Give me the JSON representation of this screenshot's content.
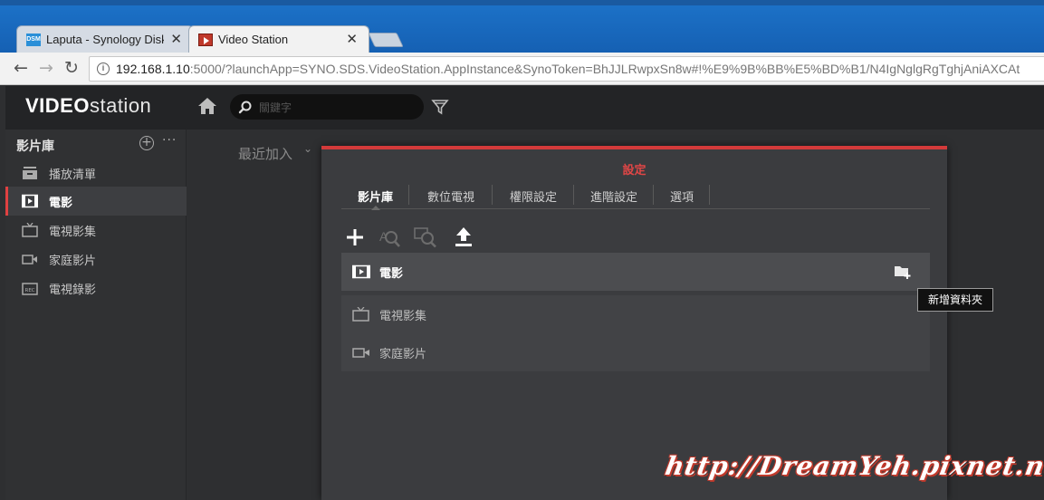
{
  "browser": {
    "tabs": [
      {
        "title": "Laputa - Synology DiskStation",
        "favicon": "dsm-icon",
        "favicon_text": "DSM",
        "active": false
      },
      {
        "title": "Video Station",
        "favicon": "video-station-icon",
        "active": true
      }
    ],
    "close_glyph": "✕",
    "url_host": "192.168.1.10",
    "url_rest": ":5000/?launchApp=SYNO.SDS.VideoStation.AppInstance&SynoToken=BhJJLRwpxSn8w#!%E9%9B%BB%E5%BD%B1/N4IgNglgRgTghjAniAXCAt",
    "back_glyph": "←",
    "forward_glyph": "→",
    "reload_glyph": "↻",
    "info_glyph": "i"
  },
  "app": {
    "logo_bold": "VIDEO",
    "logo_light": "station",
    "search_placeholder": "關鍵字"
  },
  "sidebar": {
    "header": "影片庫",
    "add_glyph": "+",
    "more_glyph": "···",
    "items": [
      {
        "label": "播放清單",
        "icon": "playlist-icon",
        "active": false
      },
      {
        "label": "電影",
        "icon": "movie-icon",
        "active": true
      },
      {
        "label": "電視影集",
        "icon": "tv-icon",
        "active": false
      },
      {
        "label": "家庭影片",
        "icon": "camcorder-icon",
        "active": false
      },
      {
        "label": "電視錄影",
        "icon": "tv-recording-icon",
        "active": false
      }
    ]
  },
  "main": {
    "sort_label": "最近加入",
    "sort_caret": "⌄"
  },
  "dialog": {
    "title": "設定",
    "tabs": [
      {
        "label": "影片庫",
        "active": true
      },
      {
        "label": "數位電視",
        "active": false
      },
      {
        "label": "權限設定",
        "active": false
      },
      {
        "label": "進階設定",
        "active": false
      },
      {
        "label": "選項",
        "active": false
      }
    ],
    "toolbar": [
      {
        "icon": "add-icon",
        "enabled": true
      },
      {
        "icon": "rescan-icon",
        "enabled": false
      },
      {
        "icon": "metadata-search-icon",
        "enabled": false
      },
      {
        "icon": "upload-icon",
        "enabled": true
      }
    ],
    "libraries": [
      {
        "label": "電影",
        "icon": "movie-icon",
        "selected": true
      },
      {
        "label": "電視影集",
        "icon": "tv-icon",
        "selected": false
      },
      {
        "label": "家庭影片",
        "icon": "camcorder-icon",
        "selected": false
      }
    ],
    "tooltip": "新增資料夾"
  },
  "watermark": "http://DreamYeh.pixnet.net"
}
